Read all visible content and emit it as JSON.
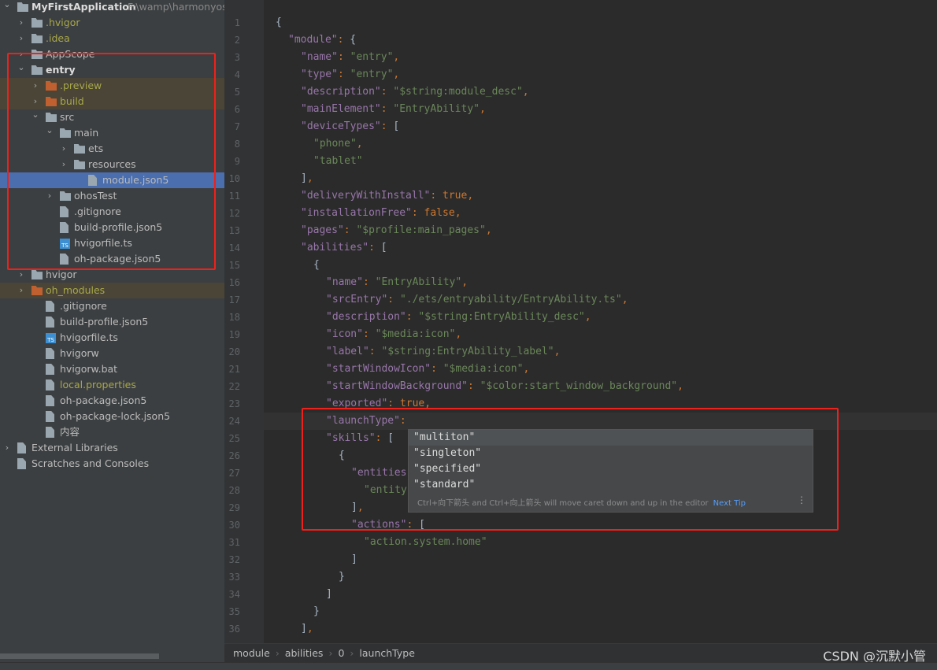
{
  "tree": [
    {
      "label": "MyFirstApplication",
      "suffix": "F:\\wamp\\harmonyos",
      "level": 0,
      "chev": "open",
      "icon": "module-folder",
      "style": "bold"
    },
    {
      "label": ".hvigor",
      "level": 1,
      "chev": "closed",
      "icon": "folder",
      "style": "olive"
    },
    {
      "label": ".idea",
      "level": 1,
      "chev": "closed",
      "icon": "folder",
      "style": "olive"
    },
    {
      "label": "AppScope",
      "level": 1,
      "chev": "closed",
      "icon": "folder"
    },
    {
      "label": "entry",
      "level": 1,
      "chev": "open",
      "icon": "module-folder",
      "style": "bold"
    },
    {
      "label": ".preview",
      "level": 2,
      "chev": "closed",
      "icon": "excluded-folder",
      "style": "olive",
      "row": "excl"
    },
    {
      "label": "build",
      "level": 2,
      "chev": "closed",
      "icon": "excluded-folder",
      "style": "olive",
      "row": "excl"
    },
    {
      "label": "src",
      "level": 2,
      "chev": "open",
      "icon": "folder"
    },
    {
      "label": "main",
      "level": 3,
      "chev": "open",
      "icon": "folder"
    },
    {
      "label": "ets",
      "level": 4,
      "chev": "closed",
      "icon": "folder"
    },
    {
      "label": "resources",
      "level": 4,
      "chev": "closed",
      "icon": "folder"
    },
    {
      "label": "module.json5",
      "level": 5,
      "icon": "json-file",
      "row": "sel"
    },
    {
      "label": "ohosTest",
      "level": 3,
      "chev": "closed",
      "icon": "folder"
    },
    {
      "label": ".gitignore",
      "level": 3,
      "icon": "ignore-file"
    },
    {
      "label": "build-profile.json5",
      "level": 3,
      "icon": "json-file"
    },
    {
      "label": "hvigorfile.ts",
      "level": 3,
      "icon": "ts-file"
    },
    {
      "label": "oh-package.json5",
      "level": 3,
      "icon": "json-file"
    },
    {
      "label": "hvigor",
      "level": 1,
      "chev": "closed",
      "icon": "folder"
    },
    {
      "label": "oh_modules",
      "level": 1,
      "chev": "closed",
      "icon": "excluded-folder",
      "style": "olive",
      "row": "excl"
    },
    {
      "label": ".gitignore",
      "level": 2,
      "icon": "ignore-file"
    },
    {
      "label": "build-profile.json5",
      "level": 2,
      "icon": "json-file"
    },
    {
      "label": "hvigorfile.ts",
      "level": 2,
      "icon": "ts-file"
    },
    {
      "label": "hvigorw",
      "level": 2,
      "icon": "shell-file"
    },
    {
      "label": "hvigorw.bat",
      "level": 2,
      "icon": "file"
    },
    {
      "label": "local.properties",
      "level": 2,
      "icon": "properties-file",
      "style": "olive"
    },
    {
      "label": "oh-package.json5",
      "level": 2,
      "icon": "json-file"
    },
    {
      "label": "oh-package-lock.json5",
      "level": 2,
      "icon": "json-file"
    },
    {
      "label": "内容",
      "level": 2,
      "icon": "file"
    },
    {
      "label": "External Libraries",
      "level": 0,
      "chev": "closed",
      "icon": "library"
    },
    {
      "label": "Scratches and Consoles",
      "level": 0,
      "icon": "scratches"
    }
  ],
  "code": [
    {
      "i": 0,
      "t": "{"
    },
    {
      "i": 1,
      "t": "\"module\": {"
    },
    {
      "i": 2,
      "t": "\"name\": \"entry\","
    },
    {
      "i": 2,
      "t": "\"type\": \"entry\","
    },
    {
      "i": 2,
      "t": "\"description\": \"$string:module_desc\","
    },
    {
      "i": 2,
      "t": "\"mainElement\": \"EntryAbility\","
    },
    {
      "i": 2,
      "t": "\"deviceTypes\": ["
    },
    {
      "i": 3,
      "t": "\"phone\","
    },
    {
      "i": 3,
      "t": "\"tablet\""
    },
    {
      "i": 2,
      "t": "],"
    },
    {
      "i": 2,
      "t": "\"deliveryWithInstall\": true,"
    },
    {
      "i": 2,
      "t": "\"installationFree\": false,"
    },
    {
      "i": 2,
      "t": "\"pages\": \"$profile:main_pages\","
    },
    {
      "i": 2,
      "t": "\"abilities\": ["
    },
    {
      "i": 3,
      "t": "{"
    },
    {
      "i": 4,
      "t": "\"name\": \"EntryAbility\","
    },
    {
      "i": 4,
      "t": "\"srcEntry\": \"./ets/entryability/EntryAbility.ts\","
    },
    {
      "i": 4,
      "t": "\"description\": \"$string:EntryAbility_desc\","
    },
    {
      "i": 4,
      "t": "\"icon\": \"$media:icon\","
    },
    {
      "i": 4,
      "t": "\"label\": \"$string:EntryAbility_label\","
    },
    {
      "i": 4,
      "t": "\"startWindowIcon\": \"$media:icon\","
    },
    {
      "i": 4,
      "t": "\"startWindowBackground\": \"$color:start_window_background\","
    },
    {
      "i": 4,
      "t": "\"exported\": true,"
    },
    {
      "i": 4,
      "t": "\"launchType\": ",
      "current": true
    },
    {
      "i": 4,
      "t": "\"skills\": ["
    },
    {
      "i": 5,
      "t": "{"
    },
    {
      "i": 6,
      "t": "\"entities\": ["
    },
    {
      "i": 7,
      "t": "\"entity.system.home\""
    },
    {
      "i": 6,
      "t": "],"
    },
    {
      "i": 6,
      "t": "\"actions\": ["
    },
    {
      "i": 7,
      "t": "\"action.system.home\""
    },
    {
      "i": 6,
      "t": "]"
    },
    {
      "i": 5,
      "t": "}"
    },
    {
      "i": 4,
      "t": "]"
    },
    {
      "i": 3,
      "t": "}"
    },
    {
      "i": 2,
      "t": "],"
    }
  ],
  "completion": {
    "options": [
      "\"multiton\"",
      "\"singleton\"",
      "\"specified\"",
      "\"standard\""
    ],
    "selected_index": 0,
    "tip": "Ctrl+向下箭头 and Ctrl+向上箭头 will move caret down and up in the editor",
    "next_tip": "Next Tip",
    "more_icon": "⋮"
  },
  "breadcrumb": [
    "module",
    "abilities",
    "0",
    "launchType"
  ],
  "watermark": "CSDN @沉默小管",
  "colors": {
    "key": "#9876aa",
    "string": "#6a8759",
    "keyword": "#cc7832",
    "highlight": "#f0201a",
    "selection": "#4b6eaf"
  }
}
